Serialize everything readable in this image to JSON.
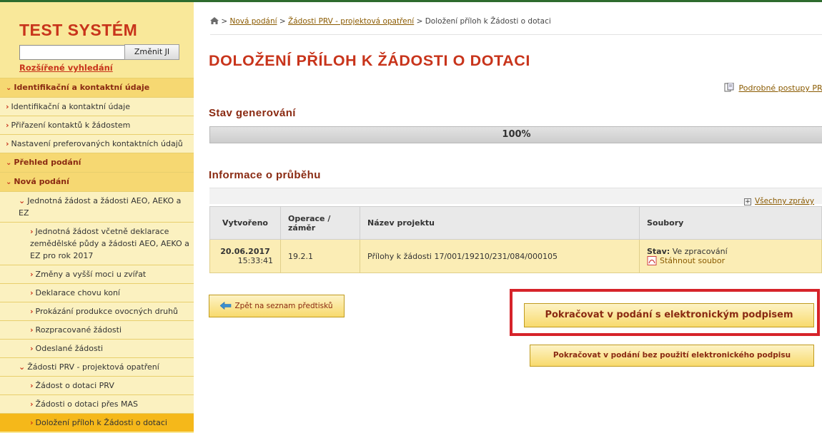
{
  "sidebar": {
    "title": "TEST SYSTÉM",
    "search_value": "",
    "change_button": "Změnit JI",
    "advanced_search": "Rozšířené vyhledání",
    "items": [
      {
        "label": "Identifikační a kontaktní údaje",
        "type": "cat",
        "marker": "⌄"
      },
      {
        "label": "Identifikační a kontaktní údaje",
        "type": "l1",
        "marker": "›"
      },
      {
        "label": "Přiřazení kontaktů k žádostem",
        "type": "l1",
        "marker": "›"
      },
      {
        "label": "Nastavení preferovaných kontaktních údajů",
        "type": "l1",
        "marker": "›"
      },
      {
        "label": "Přehled podání",
        "type": "cat",
        "marker": "⌄"
      },
      {
        "label": "Nová podání",
        "type": "cat",
        "marker": "⌄"
      },
      {
        "label": "Jednotná žádost a žádosti AEO, AEKO a EZ",
        "type": "l2",
        "marker": "⌄"
      },
      {
        "label": "Jednotná žádost včetně deklarace zemědělské půdy a žádosti AEO, AEKO a EZ pro rok 2017",
        "type": "l3",
        "marker": "›"
      },
      {
        "label": "Změny a vyšší moci u zvířat",
        "type": "l3",
        "marker": "›"
      },
      {
        "label": "Deklarace chovu koní",
        "type": "l3",
        "marker": "›"
      },
      {
        "label": "Prokázání produkce ovocných druhů",
        "type": "l3",
        "marker": "›"
      },
      {
        "label": "Rozpracované žádosti",
        "type": "l3",
        "marker": "›"
      },
      {
        "label": "Odeslané žádosti",
        "type": "l3",
        "marker": "›"
      },
      {
        "label": "Žádosti PRV - projektová opatření",
        "type": "l2",
        "marker": "⌄"
      },
      {
        "label": "Žádost o dotaci PRV",
        "type": "l3",
        "marker": "›"
      },
      {
        "label": "Žádosti o dotaci přes MAS",
        "type": "l3",
        "marker": "›"
      },
      {
        "label": "Doložení příloh k Žádosti o dotaci",
        "type": "l3 active",
        "marker": "›"
      }
    ]
  },
  "breadcrumb": {
    "sep": ">",
    "items": [
      "Nová podání",
      "Žádosti PRV - projektová opatření"
    ],
    "current": "Doložení příloh k Žádosti o dotaci"
  },
  "page_title": "DOLOŽENÍ PŘÍLOH K ŽÁDOSTI O DOTACI",
  "procedures_link": "Podrobné postupy PR",
  "generation": {
    "heading": "Stav generování",
    "progress_percent": 100,
    "progress_text": "100%"
  },
  "progress_info": {
    "heading": "Informace o průběhu",
    "all_messages": "Všechny zprávy",
    "columns": [
      "Vytvořeno",
      "Operace / záměr",
      "Název projektu",
      "Soubory"
    ],
    "row": {
      "date": "20.06.2017",
      "time": "15:33:41",
      "operation": "19.2.1",
      "project": "Přílohy k žádosti 17/001/19210/231/084/000105",
      "status_label": "Stav:",
      "status_value": "Ve zpracování",
      "download": "Stáhnout soubor"
    }
  },
  "buttons": {
    "back": "Zpět na seznam předtisků",
    "sign": "Pokračovat v podání s elektronickým podpisem",
    "no_sign": "Pokračovat v podání bez použití elektronického podpisu"
  },
  "colors": {
    "accent": "#c8341b",
    "highlight_box": "#d6232a",
    "sidebar_bg": "#f9e89a"
  }
}
